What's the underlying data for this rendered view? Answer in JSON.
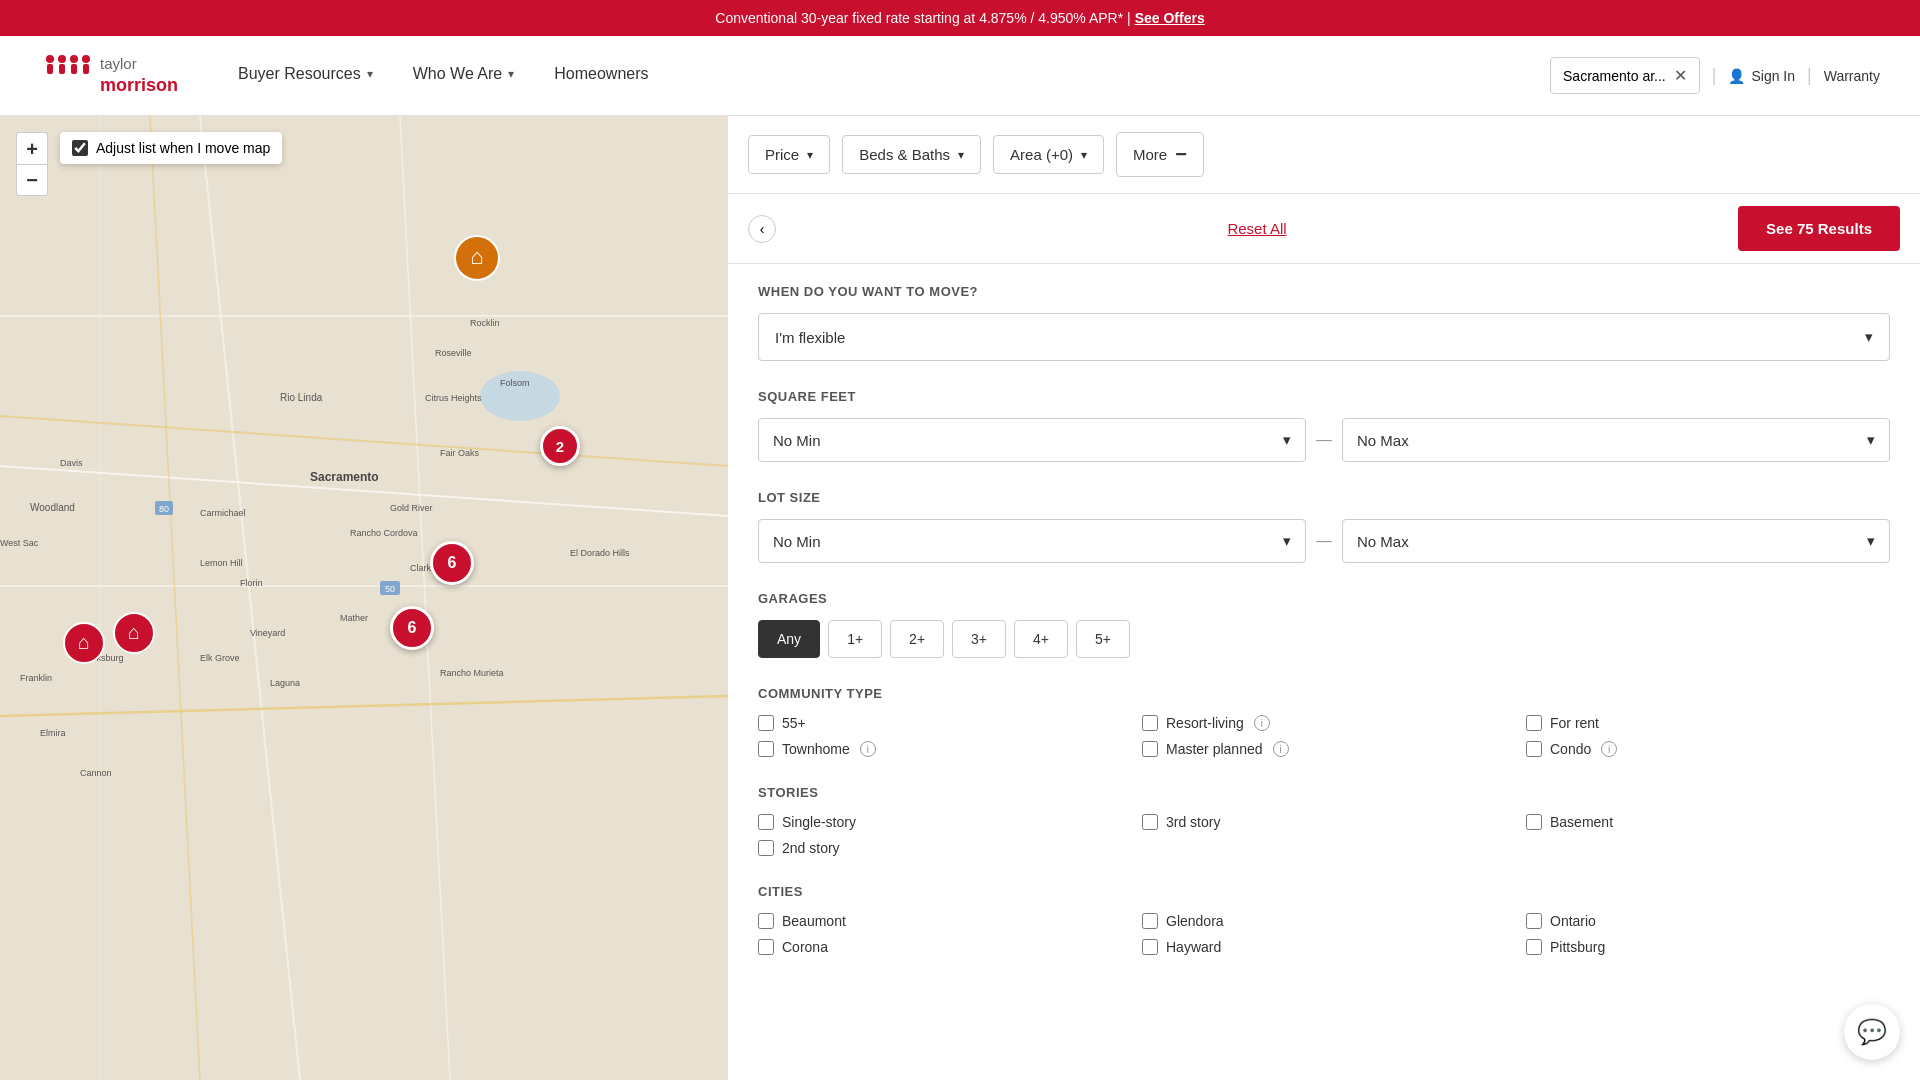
{
  "banner": {
    "text": "Conventional 30-year fixed rate starting at 4.875% / 4.950% APR* |",
    "link_text": "See Offers"
  },
  "header": {
    "logo_line1": "taylor",
    "logo_line2": "morrison",
    "nav_items": [
      {
        "label": "Buyer Resources",
        "has_dropdown": true
      },
      {
        "label": "Who We Are",
        "has_dropdown": true
      },
      {
        "label": "Homeowners",
        "has_dropdown": false
      }
    ],
    "location": "Sacramento ar...",
    "sign_in": "Sign In",
    "warranty": "Warranty"
  },
  "filter_bar": {
    "price_label": "Price",
    "beds_baths_label": "Beds & Baths",
    "area_label": "Area (+0)",
    "more_label": "More"
  },
  "action_bar": {
    "reset_label": "Reset All",
    "see_results_label": "See 75 Results"
  },
  "filters": {
    "move_section": {
      "title": "WHEN DO YOU WANT TO MOVE?",
      "value": "I'm flexible"
    },
    "sqft_section": {
      "title": "SQUARE FEET",
      "min_label": "No Min",
      "max_label": "No Max"
    },
    "lot_section": {
      "title": "LOT SIZE",
      "min_label": "No Min",
      "max_label": "No Max"
    },
    "garages_section": {
      "title": "GARAGES",
      "options": [
        "Any",
        "1+",
        "2+",
        "3+",
        "4+",
        "5+"
      ],
      "active": "Any"
    },
    "community_section": {
      "title": "COMMUNITY TYPE",
      "options": [
        {
          "label": "55+",
          "info": false
        },
        {
          "label": "Resort-living",
          "info": true
        },
        {
          "label": "For rent",
          "info": false
        },
        {
          "label": "Townhome",
          "info": true
        },
        {
          "label": "Master planned",
          "info": true
        },
        {
          "label": "Condo",
          "info": true
        }
      ]
    },
    "stories_section": {
      "title": "STORIES",
      "options": [
        {
          "label": "Single-story"
        },
        {
          "label": "3rd story"
        },
        {
          "label": "Basement"
        },
        {
          "label": "2nd story"
        }
      ]
    },
    "cities_section": {
      "title": "CITIES",
      "options": [
        {
          "label": "Beaumont"
        },
        {
          "label": "Glendora"
        },
        {
          "label": "Ontario"
        },
        {
          "label": "Corona"
        },
        {
          "label": "Hayward"
        },
        {
          "label": "Pittsburg"
        }
      ]
    }
  },
  "map": {
    "adjust_label": "Adjust list when I move map",
    "markers": [
      {
        "type": "cluster",
        "value": "6",
        "position": "top:425px;left:430px"
      },
      {
        "type": "cluster",
        "value": "6",
        "position": "top:490px;left:390px"
      },
      {
        "type": "cluster",
        "value": "2",
        "position": "top:310px;left:540px"
      }
    ]
  },
  "chat": {
    "icon": "💬"
  }
}
